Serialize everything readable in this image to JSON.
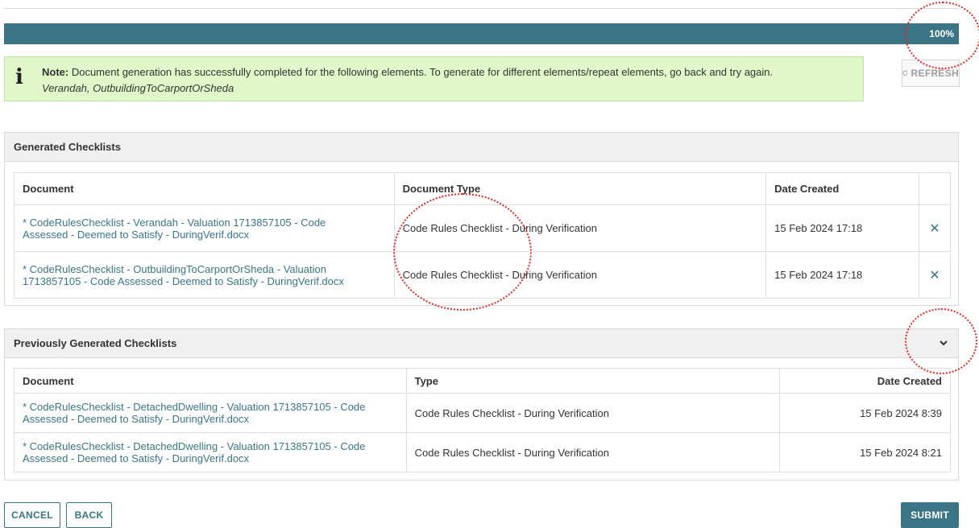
{
  "progress": {
    "percent_text": "100%",
    "value": 1.0,
    "color": "#3b7585"
  },
  "note": {
    "label": "Note:",
    "message": " Document generation has successfully completed for the following elements. To generate for different elements/repeat elements, go back and try again.",
    "elements": "Verandah, OutbuildingToCarportOrSheda",
    "icon": "info-icon"
  },
  "refresh": {
    "label": "REFRESH",
    "icon": "refresh-icon"
  },
  "generated": {
    "title": "Generated Checklists",
    "columns": [
      "Document",
      "Document Type",
      "Date Created"
    ],
    "rows": [
      {
        "document_line1": "* CodeRulesChecklist - Verandah - Valuation 1713857105 - Code",
        "document_line2": "Assessed - Deemed to Satisfy - DuringVerif.docx",
        "type": "Code Rules Checklist - During Verification",
        "date": "15 Feb 2024 17:18",
        "action_icon": "delete-x-icon"
      },
      {
        "document_line1": "* CodeRulesChecklist - OutbuildingToCarportOrSheda - Valuation",
        "document_line2": "1713857105 - Code Assessed - Deemed to Satisfy - DuringVerif.docx",
        "type": "Code Rules Checklist - During Verification",
        "date": "15 Feb 2024 17:18",
        "action_icon": "delete-x-icon"
      }
    ]
  },
  "previous": {
    "title": "Previously Generated Checklists",
    "columns": [
      "Document",
      "Type",
      "Date Created"
    ],
    "rows": [
      {
        "document_line1": "* CodeRulesChecklist - DetachedDwelling - Valuation 1713857105 - Code",
        "document_line2": "Assessed - Deemed to Satisfy - DuringVerif.docx",
        "type": "Code Rules Checklist - During Verification",
        "date": "15 Feb 2024 8:39"
      },
      {
        "document_line1": "* CodeRulesChecklist - DetachedDwelling - Valuation 1713857105 - Code",
        "document_line2": "Assessed - Deemed to Satisfy - DuringVerif.docx",
        "type": "Code Rules Checklist - During Verification",
        "date": "15 Feb 2024 8:21"
      }
    ]
  },
  "buttons": {
    "cancel": "CANCEL",
    "back": "BACK",
    "submit": "SUBMIT"
  },
  "colors": {
    "accent": "#3b7585",
    "note_bg": "#dff7c9",
    "annotation": "#d62b2b"
  }
}
